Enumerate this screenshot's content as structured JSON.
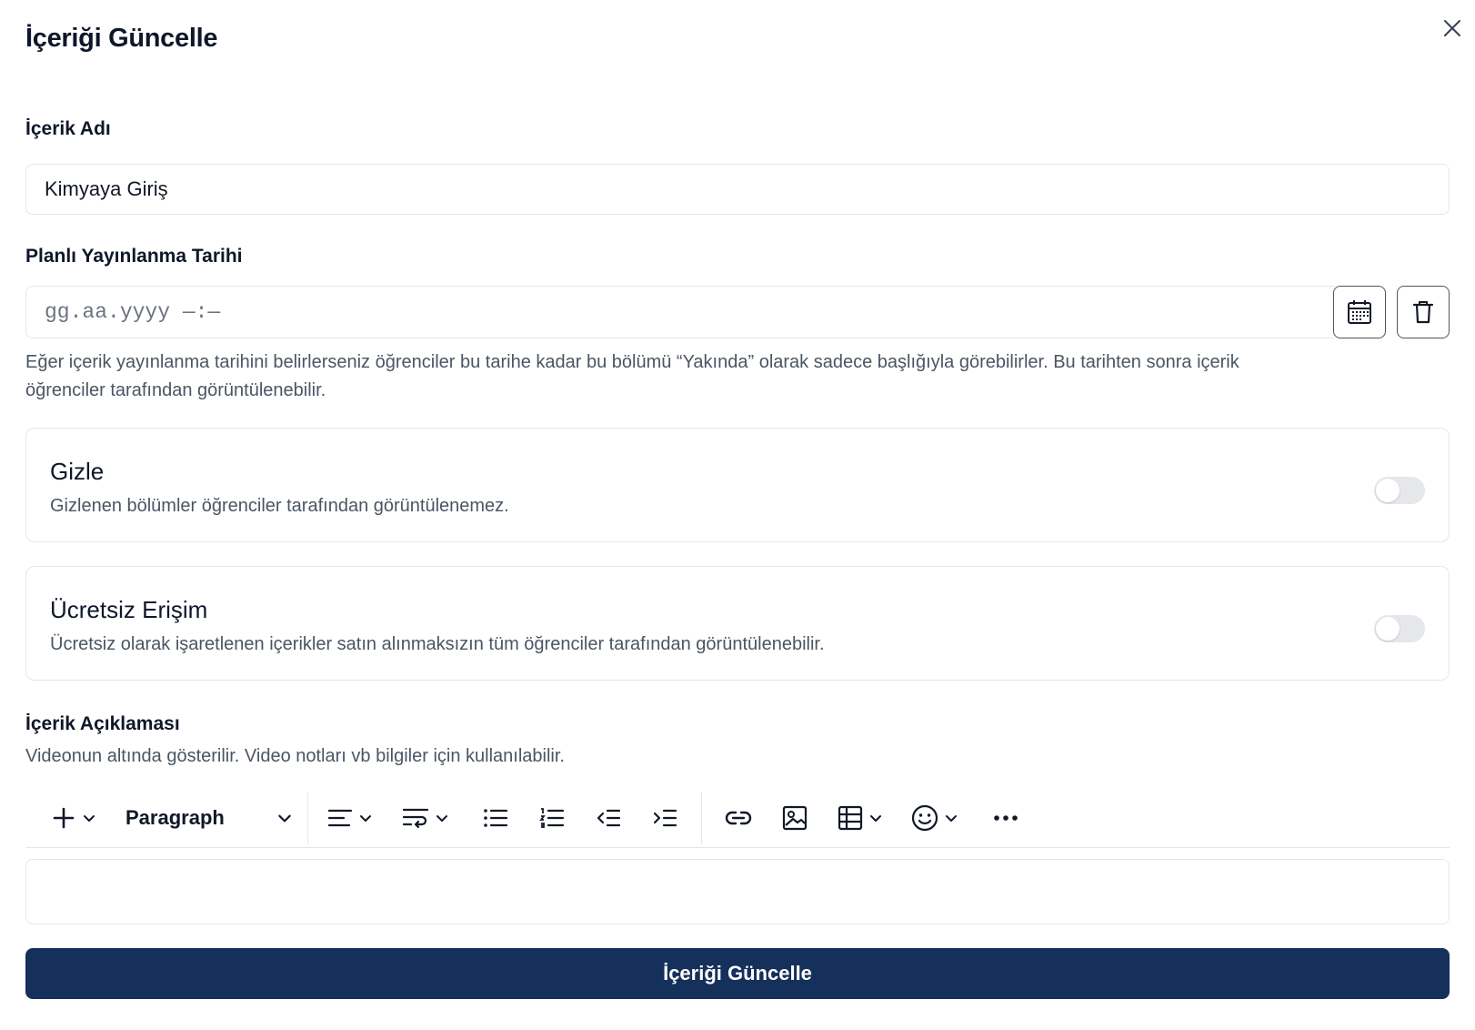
{
  "dialog": {
    "title": "İçeriği Güncelle",
    "close_icon": "close-icon"
  },
  "content_name": {
    "label": "İçerik Adı",
    "value": "Kimyaya Giriş"
  },
  "publish_date": {
    "label": "Planlı Yayınlanma Tarihi",
    "placeholder": "gg.aa.yyyy —:—",
    "calendar_icon": "calendar-icon",
    "delete_icon": "trash-icon",
    "help_line1": "Eğer içerik yayınlanma tarihini belirlerseniz öğrenciler bu tarihe kadar bu bölümü “Yakında” olarak sadece başlığıyla görebilirler. Bu tarihten sonra içerik",
    "help_line2": "öğrenciler tarafından görüntülenebilir."
  },
  "hide_toggle": {
    "title": "Gizle",
    "description": "Gizlenen bölümler öğrenciler tarafından görüntülenemez.",
    "enabled": false
  },
  "free_access_toggle": {
    "title": "Ücretsiz Erişim",
    "description": "Ücretsiz olarak işaretlenen içerikler satın alınmaksızın tüm öğrenciler tarafından görüntülenebilir.",
    "enabled": false
  },
  "description_editor": {
    "label": "İçerik Açıklaması",
    "help": "Videonun altında gösterilir. Video notları vb bilgiler için kullanılabilir.",
    "block_type": "Paragraph",
    "toolbar_icons": [
      "plus-icon",
      "align-left-icon",
      "text-wrap-icon",
      "bullet-list-icon",
      "numbered-list-icon",
      "outdent-icon",
      "indent-icon",
      "link-icon",
      "image-icon",
      "table-icon",
      "emoji-icon",
      "more-icon"
    ]
  },
  "submit": {
    "label": "İçeriği Güncelle",
    "color": "#14305b"
  }
}
